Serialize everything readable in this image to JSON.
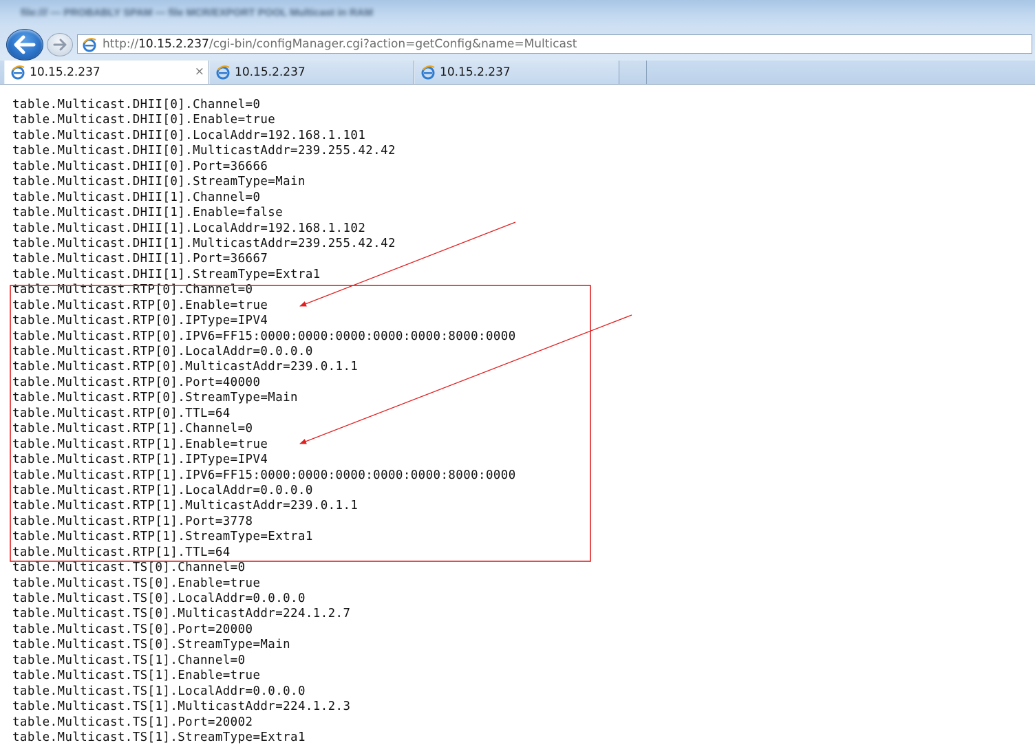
{
  "window": {
    "title_blurred": "file:/// — PROBABLY SPAM — file MCR/EXPORT POOL Multicast in RAM"
  },
  "navigation": {
    "back_icon": "back-arrow-icon",
    "forward_icon": "forward-arrow-icon",
    "address_icon": "ie-page-icon",
    "address_prefix": "http://",
    "address_host": "10.15.2.237",
    "address_path": "/cgi-bin/configManager.cgi?action=getConfig&name=Multicast"
  },
  "tabs": [
    {
      "label": "10.15.2.237",
      "close": "×",
      "icon": "ie-page-icon",
      "active": true
    },
    {
      "label": "10.15.2.237",
      "icon": "ie-page-icon",
      "active": false
    },
    {
      "label": "10.15.2.237",
      "icon": "ie-page-icon",
      "active": false
    }
  ],
  "annotations": {
    "highlight_color": "#e02020",
    "arrow_color": "#e02020"
  },
  "config_lines": [
    "table.Multicast.DHII[0].Channel=0",
    "table.Multicast.DHII[0].Enable=true",
    "table.Multicast.DHII[0].LocalAddr=192.168.1.101",
    "table.Multicast.DHII[0].MulticastAddr=239.255.42.42",
    "table.Multicast.DHII[0].Port=36666",
    "table.Multicast.DHII[0].StreamType=Main",
    "table.Multicast.DHII[1].Channel=0",
    "table.Multicast.DHII[1].Enable=false",
    "table.Multicast.DHII[1].LocalAddr=192.168.1.102",
    "table.Multicast.DHII[1].MulticastAddr=239.255.42.42",
    "table.Multicast.DHII[1].Port=36667",
    "table.Multicast.DHII[1].StreamType=Extra1",
    "table.Multicast.RTP[0].Channel=0",
    "table.Multicast.RTP[0].Enable=true",
    "table.Multicast.RTP[0].IPType=IPV4",
    "table.Multicast.RTP[0].IPV6=FF15:0000:0000:0000:0000:0000:8000:0000",
    "table.Multicast.RTP[0].LocalAddr=0.0.0.0",
    "table.Multicast.RTP[0].MulticastAddr=239.0.1.1",
    "table.Multicast.RTP[0].Port=40000",
    "table.Multicast.RTP[0].StreamType=Main",
    "table.Multicast.RTP[0].TTL=64",
    "table.Multicast.RTP[1].Channel=0",
    "table.Multicast.RTP[1].Enable=true",
    "table.Multicast.RTP[1].IPType=IPV4",
    "table.Multicast.RTP[1].IPV6=FF15:0000:0000:0000:0000:0000:8000:0000",
    "table.Multicast.RTP[1].LocalAddr=0.0.0.0",
    "table.Multicast.RTP[1].MulticastAddr=239.0.1.1",
    "table.Multicast.RTP[1].Port=3778",
    "table.Multicast.RTP[1].StreamType=Extra1",
    "table.Multicast.RTP[1].TTL=64",
    "table.Multicast.TS[0].Channel=0",
    "table.Multicast.TS[0].Enable=true",
    "table.Multicast.TS[0].LocalAddr=0.0.0.0",
    "table.Multicast.TS[0].MulticastAddr=224.1.2.7",
    "table.Multicast.TS[0].Port=20000",
    "table.Multicast.TS[0].StreamType=Main",
    "table.Multicast.TS[1].Channel=0",
    "table.Multicast.TS[1].Enable=true",
    "table.Multicast.TS[1].LocalAddr=0.0.0.0",
    "table.Multicast.TS[1].MulticastAddr=224.1.2.3",
    "table.Multicast.TS[1].Port=20002",
    "table.Multicast.TS[1].StreamType=Extra1"
  ]
}
